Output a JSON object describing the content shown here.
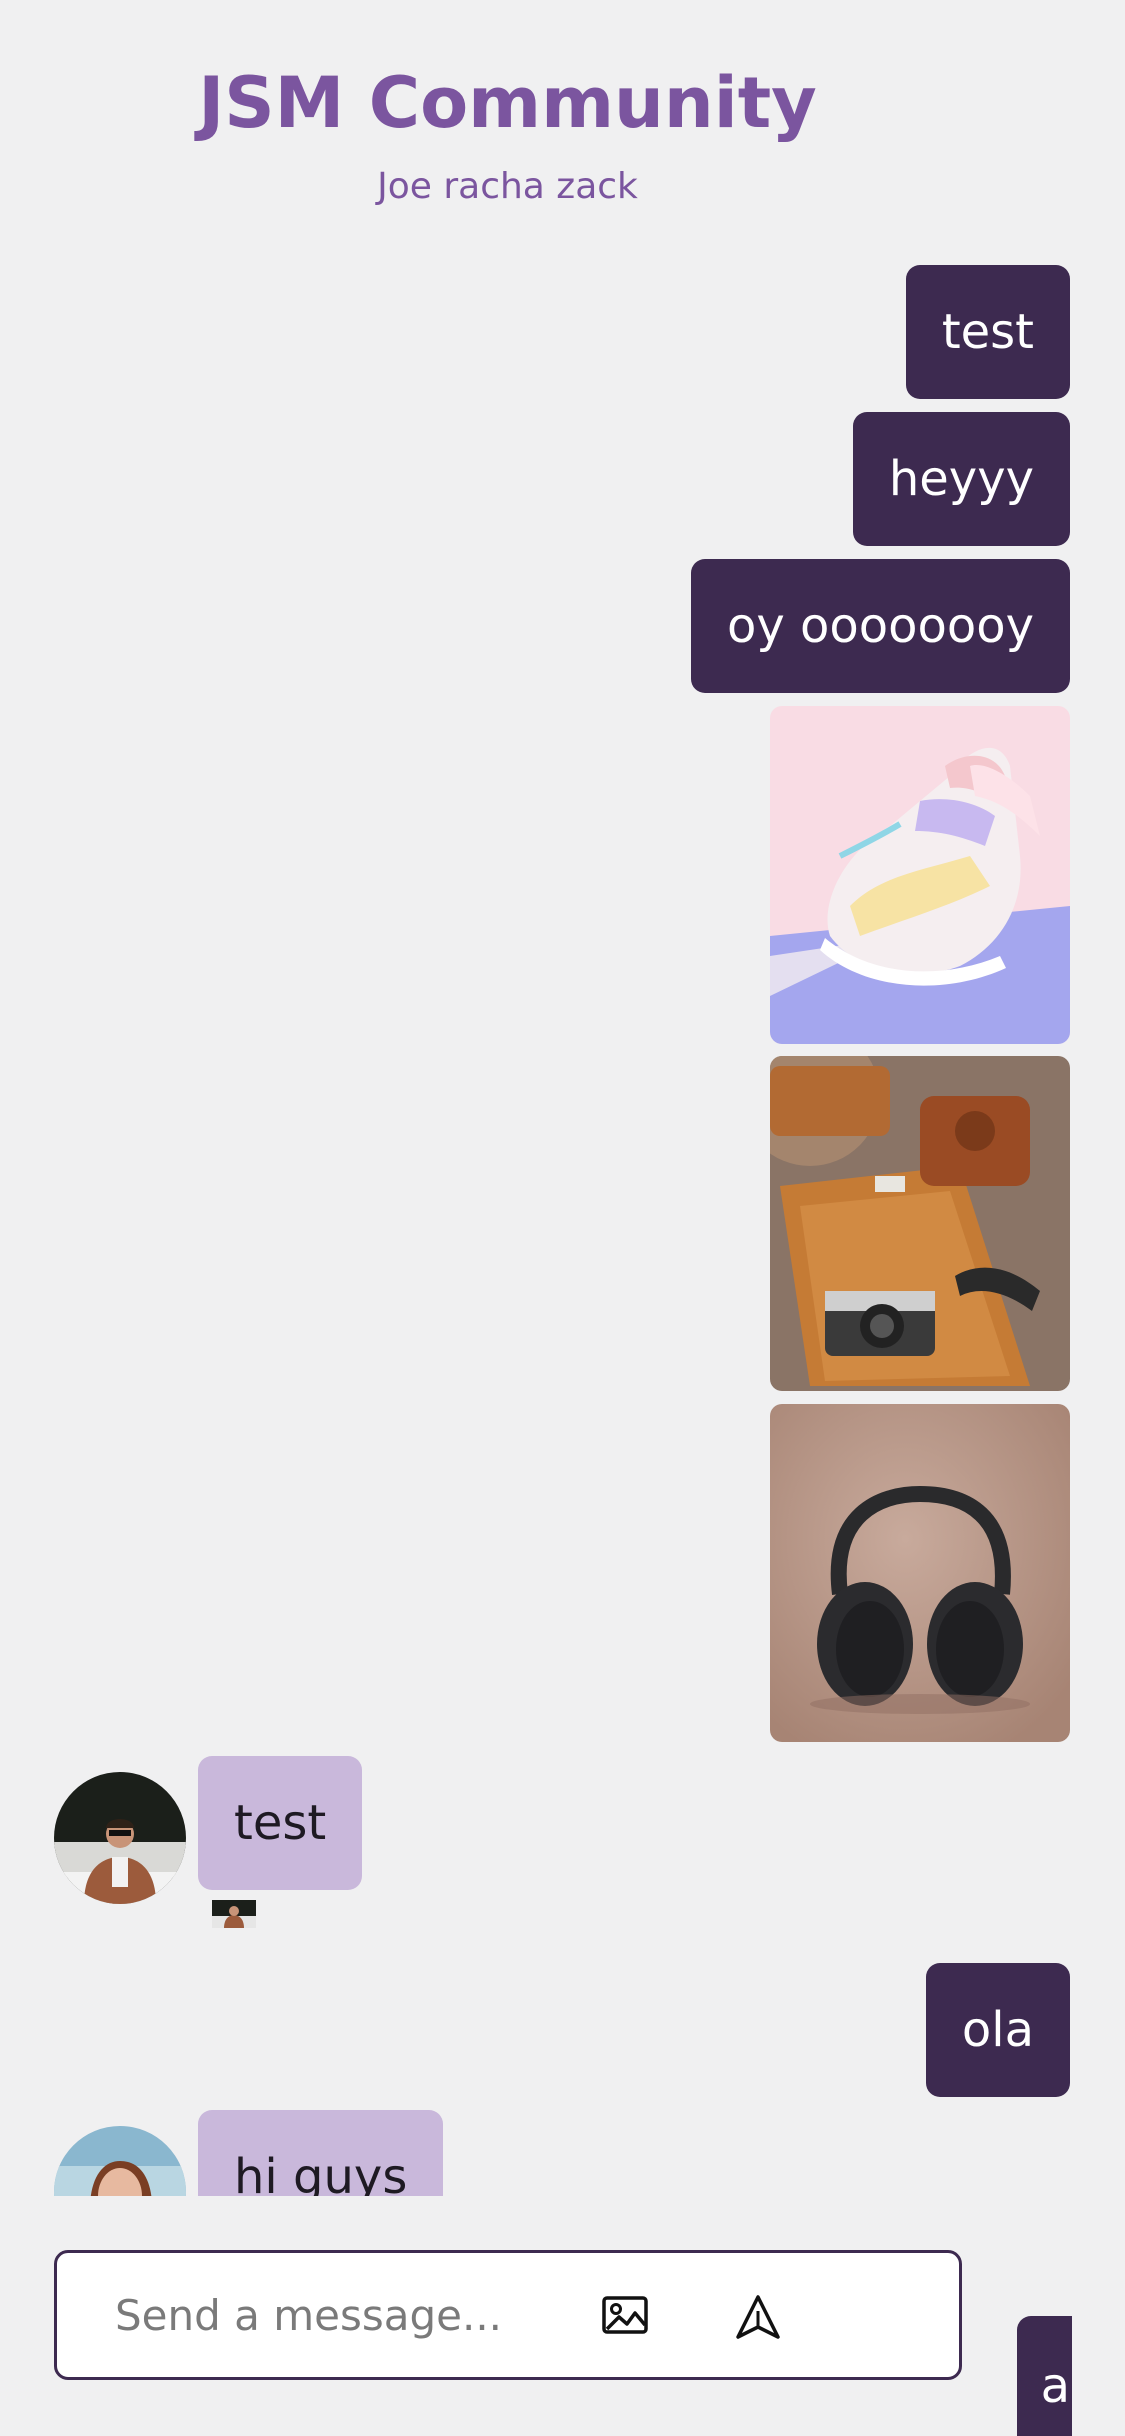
{
  "header": {
    "title": "JSM Community",
    "members": "Joe racha zack"
  },
  "messages": {
    "m1": "test",
    "m2": "heyyy",
    "m3": "oy oooooooy",
    "m4": "test",
    "m5": "ola",
    "m6": "hi guys",
    "m7": "a"
  },
  "composer": {
    "placeholder": "Send a message...",
    "image_icon": "image-icon",
    "send_icon": "send-icon"
  },
  "colors": {
    "accent": "#7b559f",
    "outgoing_bubble": "#3d2a50",
    "incoming_bubble": "#c9b8db",
    "background": "#f0f0f1"
  }
}
